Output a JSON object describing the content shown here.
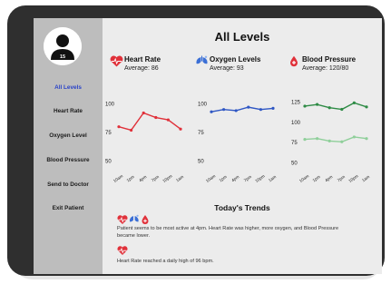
{
  "app": {
    "title": "All Levels",
    "patient_number": "15"
  },
  "sidebar": {
    "items": [
      {
        "label": "All Levels",
        "active": true
      },
      {
        "label": "Heart Rate",
        "active": false
      },
      {
        "label": "Oxygen Level",
        "active": false
      },
      {
        "label": "Blood Pressure",
        "active": false
      },
      {
        "label": "Send to Doctor",
        "active": false
      },
      {
        "label": "Exit Patient",
        "active": false
      }
    ]
  },
  "metrics": [
    {
      "name": "Heart Rate",
      "average": "Average: 86",
      "icon": "heart-pulse-icon",
      "color": "#e0313a"
    },
    {
      "name": "Oxygen Levels",
      "average": "Average: 93",
      "icon": "lungs-icon",
      "color": "#3b6fd6"
    },
    {
      "name": "Blood Pressure",
      "average": "Average: 120/80",
      "icon": "blood-drop-icon",
      "color": "#e0313a"
    }
  ],
  "chart_data": [
    {
      "type": "line",
      "categories": [
        "10am",
        "1pm",
        "4pm",
        "7pm",
        "10pm",
        "1am"
      ],
      "series": [
        {
          "values": [
            80,
            77,
            92,
            88,
            86,
            78
          ],
          "color": "#e0313a"
        }
      ],
      "yticks": [
        100,
        75,
        50
      ],
      "ylim": [
        45,
        105
      ],
      "grid": false
    },
    {
      "type": "line",
      "categories": [
        "10am",
        "1pm",
        "4pm",
        "7pm",
        "10pm",
        "1am"
      ],
      "series": [
        {
          "values": [
            93,
            95,
            94,
            97,
            95,
            96
          ],
          "color": "#2f57c4"
        }
      ],
      "yticks": [
        100,
        75,
        50
      ],
      "ylim": [
        45,
        105
      ],
      "grid": false
    },
    {
      "type": "line",
      "categories": [
        "10am",
        "1pm",
        "4pm",
        "7pm",
        "10pm",
        "1am"
      ],
      "series": [
        {
          "values": [
            120,
            122,
            118,
            116,
            124,
            119
          ],
          "color": "#2e8b45"
        },
        {
          "values": [
            79,
            80,
            77,
            76,
            82,
            80
          ],
          "color": "#8fcf9a"
        }
      ],
      "yticks": [
        125,
        100,
        75,
        50
      ],
      "ylim": [
        45,
        130
      ],
      "grid": false
    }
  ],
  "trends": {
    "title": "Today's Trends",
    "items": [
      {
        "text": "Patient seems to be most active at 4pm. Heart Rate was higher, more oxygen, and Blood Pressure became lower."
      },
      {
        "text": "Heart Rate reached a daily high of 96 bpm."
      }
    ]
  }
}
